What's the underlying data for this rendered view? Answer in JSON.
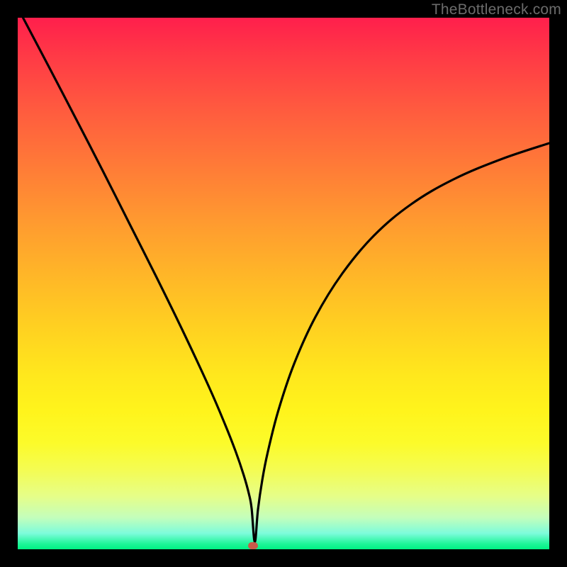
{
  "watermark": "TheBottleneck.com",
  "chart_data": {
    "type": "line",
    "title": "",
    "xlabel": "",
    "ylabel": "",
    "xlim": [
      0,
      100
    ],
    "ylim": [
      0,
      100
    ],
    "grid": false,
    "legend": false,
    "series": [
      {
        "name": "bottleneck-curve",
        "color": "#000000",
        "x": [
          1,
          6,
          11,
          16,
          21,
          26,
          31,
          36,
          39,
          41,
          42.5,
          43.5,
          44,
          44.6,
          45.2,
          46,
          47,
          49,
          52,
          56,
          61,
          67,
          74,
          82,
          91,
          100
        ],
        "y": [
          100,
          90.5,
          80.9,
          71.2,
          61.3,
          51.4,
          41.2,
          30.5,
          23.5,
          18.4,
          14.0,
          10.4,
          7.7,
          1.4,
          7.5,
          13.0,
          18.1,
          26.0,
          34.9,
          43.7,
          51.8,
          59.0,
          64.9,
          69.6,
          73.4,
          76.4
        ]
      }
    ],
    "marker": {
      "x": 44.3,
      "y": 0.7,
      "color": "#c95b49"
    },
    "background_gradient": {
      "top": "#ff1f4c",
      "mid": "#ffe71d",
      "bottom": "#00f183"
    }
  }
}
